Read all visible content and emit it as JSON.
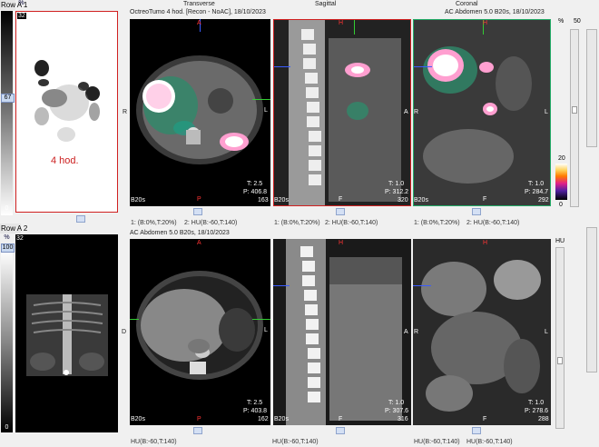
{
  "rows": [
    {
      "label": "Row A 1",
      "colorbar_top": "%",
      "colorbar_pct": "67",
      "colorbar_zero": "0",
      "mip_num": "32",
      "mip_label": "4 hod.",
      "header": "OctreoTumo 4 hod. [Recon - NoAC], 18/10/2023",
      "views": [
        {
          "title": "Transverse",
          "ori_top": "A",
          "ori_bottom": "P",
          "ori_left": "R",
          "ori_right": "L",
          "t": "T: 2.5",
          "p": "P: 406.8",
          "num": "163",
          "bl": "B20s"
        },
        {
          "title": "Sagittal",
          "ori_top": "H",
          "ori_bottom": "F",
          "ori_left": "",
          "ori_right": "A",
          "t": "T: 1.0",
          "p": "P: 312.2",
          "num": "320",
          "bl": "B20s"
        },
        {
          "title": "Coronal",
          "ori_top": "H",
          "ori_bottom": "F",
          "ori_left": "R",
          "ori_right": "L",
          "t": "T: 1.0",
          "p": "P: 284.7",
          "num": "292",
          "bl": "B20s"
        }
      ],
      "top_right": "AC Abdomen  5.0  B20s, 18/10/2023",
      "wl": [
        "1: (B:0%,T:20%)",
        "2: HU(B:-60,T:140)",
        "1: (B:0%,T:20%)",
        "2: HU(B:-60,T:140)",
        "1: (B:0%,T:20%)",
        "2: HU(B:-60,T:140)"
      ]
    },
    {
      "label": "Row A 2",
      "colorbar_top": "%",
      "colorbar_pct": "100",
      "colorbar_zero": "0",
      "mip_num": "32",
      "header": "AC  Abdomen  5.0  B20s, 18/10/2023",
      "views": [
        {
          "ori_top": "A",
          "ori_bottom": "P",
          "ori_left": "D",
          "ori_right": "L",
          "t": "T: 2.5",
          "p": "P: 403.8",
          "num": "162",
          "bl": "B20s"
        },
        {
          "ori_top": "H",
          "ori_bottom": "F",
          "ori_left": "",
          "ori_right": "A",
          "t": "T: 1.0",
          "p": "P: 307.6",
          "num": "316",
          "bl": "B20s"
        },
        {
          "ori_top": "H",
          "ori_bottom": "F",
          "ori_left": "R",
          "ori_right": "L",
          "t": "T: 1.0",
          "p": "P: 278.6",
          "num": "288",
          "bl": ""
        }
      ],
      "wl": [
        "HU(B:-60,T:140)",
        "HU(B:-60,T:140)",
        "HU(B:-60,T:140)",
        "HU(B:-60,T:140)"
      ]
    }
  ],
  "right_panel": {
    "pct": "%",
    "top": "50",
    "mid": "20",
    "bottom": "0",
    "unit": "HU"
  },
  "colors": {
    "selection": "#d02020",
    "crosshair_h": "#3a5cff",
    "crosshair_v": "#33cc33",
    "text_red": "#cc2020"
  }
}
